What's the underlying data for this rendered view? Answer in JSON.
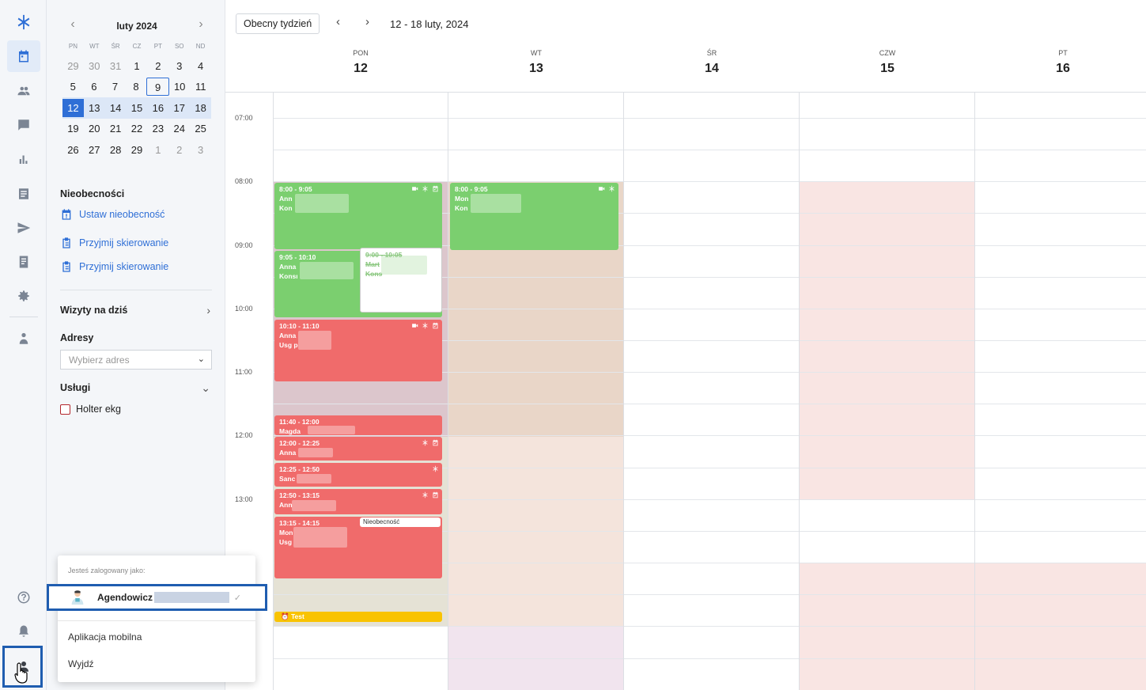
{
  "rail": {
    "icons": [
      "logo-icon",
      "calendar-icon",
      "patients-icon",
      "chat-icon",
      "stats-icon",
      "documents-icon",
      "send-icon",
      "reports-icon",
      "settings-icon",
      "doctor-icon",
      "help-icon",
      "bell-icon",
      "user-icon"
    ]
  },
  "mini_calendar": {
    "title": "luty 2024",
    "dow": [
      "PN",
      "WT",
      "ŚR",
      "CZ",
      "PT",
      "SO",
      "ND"
    ],
    "weeks": [
      [
        "29",
        "30",
        "31",
        "1",
        "2",
        "3",
        "4"
      ],
      [
        "5",
        "6",
        "7",
        "8",
        "9",
        "10",
        "11"
      ],
      [
        "12",
        "13",
        "14",
        "15",
        "16",
        "17",
        "18"
      ],
      [
        "19",
        "20",
        "21",
        "22",
        "23",
        "24",
        "25"
      ],
      [
        "26",
        "27",
        "28",
        "29",
        "1",
        "2",
        "3"
      ]
    ]
  },
  "sidebar": {
    "absences_title": "Nieobecności",
    "set_absence": "Ustaw nieobecność",
    "referral_1": "Przyjmij skierowanie",
    "referral_2": "Przyjmij skierowanie",
    "visits_today": "Wizyty na dziś",
    "addresses_label": "Adresy",
    "address_placeholder": "Wybierz adres",
    "services_label": "Usługi",
    "service_1": "Holter ekg"
  },
  "toolbar": {
    "current_week": "Obecny tydzień",
    "range": "12 - 18 luty, 2024"
  },
  "days": [
    {
      "dow": "PON",
      "num": "12"
    },
    {
      "dow": "WT",
      "num": "13"
    },
    {
      "dow": "ŚR",
      "num": "14"
    },
    {
      "dow": "CZW",
      "num": "15"
    },
    {
      "dow": "PT",
      "num": "16"
    }
  ],
  "times": [
    "07:00",
    "08:00",
    "09:00",
    "10:00",
    "11:00",
    "12:00",
    "13:00"
  ],
  "events": {
    "e1": {
      "time": "8:00 - 9:05",
      "l1": "Ann",
      "l2": "Kon"
    },
    "e2": {
      "time": "9:05 - 10:10",
      "l1": "Anna",
      "l2": "Konsı"
    },
    "e3": {
      "time": "9:00 - 10:05",
      "l1": "Mart",
      "l2": "Kons"
    },
    "e4": {
      "time": "10:10 - 11:10",
      "l1": "Anna",
      "l2": "Usg p"
    },
    "e5": {
      "time": "11:40 - 12:00",
      "l1": "Magda"
    },
    "e6": {
      "time": "12:00 - 12:25",
      "l1": "Anna"
    },
    "e7": {
      "time": "12:25 - 12:50",
      "l1": "Sanc"
    },
    "e8": {
      "time": "12:50 - 13:15",
      "l1": "Ann"
    },
    "e9": {
      "time": "13:15 - 14:15",
      "l1": "Mon",
      "l2": "Usg",
      "badge": "Nieobecność"
    },
    "e10": {
      "label": "Test"
    },
    "t1": {
      "time": "8:00 - 9:05",
      "l1": "Mon",
      "l2": "Kon"
    }
  },
  "popup": {
    "caption": "Jesteś zalogowany jako:",
    "username": "Agendowicz",
    "mobile_app": "Aplikacja mobilna",
    "logout": "Wyjdź"
  },
  "colors": {
    "accent": "#2f6fd6",
    "event_green": "#7bcf6f",
    "event_red": "#f06b6b",
    "event_yellow": "#f9c302"
  }
}
